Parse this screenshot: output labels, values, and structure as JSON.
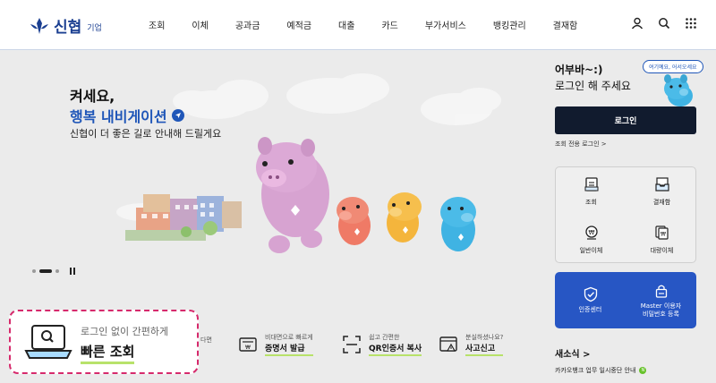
{
  "header": {
    "logo_text": "신협",
    "logo_sub": "기업",
    "nav": [
      "조회",
      "이체",
      "공과금",
      "예적금",
      "대출",
      "카드",
      "부가서비스",
      "뱅킹관리",
      "결재함"
    ],
    "icons": [
      "user-icon",
      "search-icon",
      "grid-menu-icon"
    ]
  },
  "hero": {
    "line1": "켜세요,",
    "line2": "행복 내비게이션",
    "line3": "신협이 더 좋은 길로 안내해 드릴게요",
    "slides_total": 3,
    "slide_active": 2
  },
  "fast_lookup": {
    "small": "로그인 없이 간편하게",
    "big": "빠른 조회"
  },
  "quick_menu": {
    "cut_text": "다면",
    "items": [
      {
        "small": "비대면으로 빠르게",
        "big": "증명서 발급",
        "icon": "certificate-icon"
      },
      {
        "small": "쉽고 간편한",
        "big": "QR인증서 복사",
        "icon": "qr-scan-icon"
      },
      {
        "small": "분실하셨나요?",
        "big": "사고신고",
        "icon": "warning-window-icon"
      }
    ]
  },
  "panel": {
    "greet1": "어부바~:)",
    "greet2": "로그인 해 주세요",
    "bubble": "여기예요, 어서오세요",
    "login_button": "로그인",
    "login_sub": "조회 전용 로그인 >",
    "menu": [
      {
        "label": "조회",
        "icon": "document-icon"
      },
      {
        "label": "결재함",
        "icon": "inbox-icon"
      },
      {
        "label": "일반이체",
        "icon": "won-transfer-icon"
      },
      {
        "label": "대량이체",
        "icon": "bulk-transfer-icon"
      }
    ],
    "blue_menu": [
      {
        "label": "인증센터",
        "icon": "shield-check-icon"
      },
      {
        "label": "Master 이용자\n비밀번호 등록",
        "icon": "lock-icon"
      }
    ],
    "news_title": "새소식 >",
    "news_item": "카카오뱅크 업무 일시중단 안내",
    "news_badge": "N"
  },
  "colors": {
    "brand_blue": "#1b3f91",
    "accent_blue": "#2756c4",
    "dark_button": "#111b2e",
    "highlight_dashed": "#d62a6c",
    "underline_green": "#b8e26a"
  }
}
